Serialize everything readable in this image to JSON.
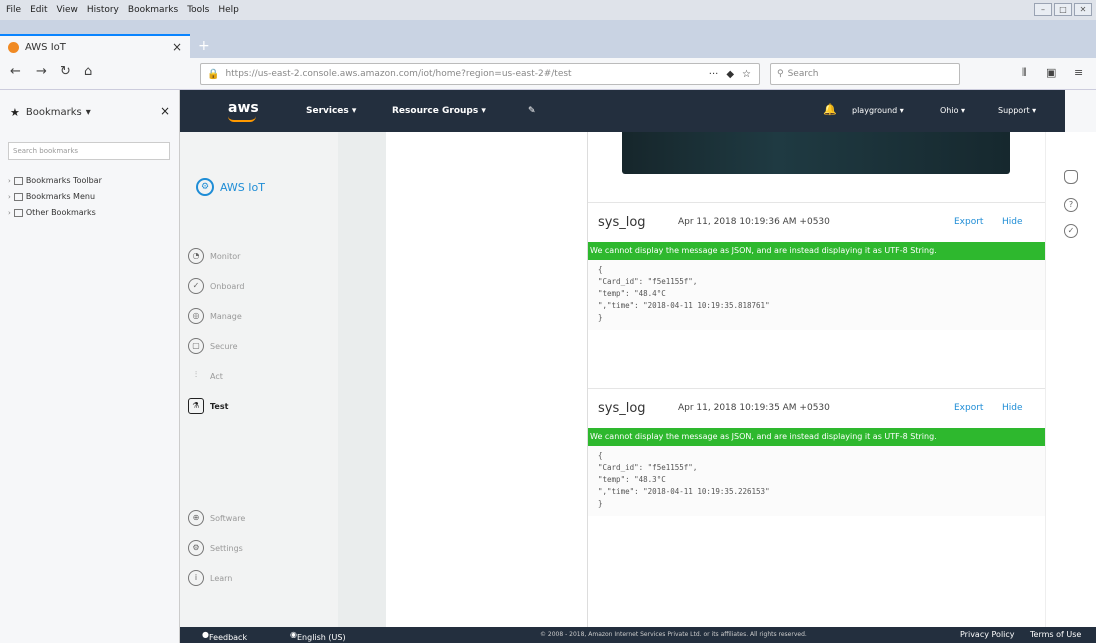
{
  "menubar": {
    "items": [
      "File",
      "Edit",
      "View",
      "History",
      "Bookmarks",
      "Tools",
      "Help"
    ]
  },
  "tab": {
    "title": "AWS IoT",
    "close": "×",
    "newtab": "+"
  },
  "nav": {
    "url": "https://us-east-2.console.aws.amazon.com/iot/home?region=us-east-2#/test",
    "more": "···",
    "search_placeholder": "Search"
  },
  "bookmarks": {
    "title": "Bookmarks",
    "close": "×",
    "search_placeholder": "Search bookmarks",
    "items": [
      "Bookmarks Toolbar",
      "Bookmarks Menu",
      "Other Bookmarks"
    ]
  },
  "aws": {
    "logo": "aws",
    "services": "Services",
    "resource_groups": "Resource Groups",
    "account": "playground",
    "region": "Ohio",
    "support": "Support"
  },
  "iot": {
    "title": "AWS IoT",
    "nav": [
      "Monitor",
      "Onboard",
      "Manage",
      "Secure",
      "Act",
      "Test"
    ],
    "bottom_nav": [
      "Software",
      "Settings",
      "Learn"
    ]
  },
  "messages": [
    {
      "topic": "sys_log",
      "timestamp": "Apr 11, 2018 10:19:36 AM +0530",
      "export": "Export",
      "hide": "Hide",
      "banner": "We cannot display the message as JSON, and are instead displaying it as UTF-8 String.",
      "payload": "{\n\"Card_id\": \"f5e1155f\",\n\"temp\": \"48.4°C\n\",\"time\": \"2018-04-11 10:19:35.818761\"\n}"
    },
    {
      "topic": "sys_log",
      "timestamp": "Apr 11, 2018 10:19:35 AM +0530",
      "export": "Export",
      "hide": "Hide",
      "banner": "We cannot display the message as JSON, and are instead displaying it as UTF-8 String.",
      "payload": "{\n\"Card_id\": \"f5e1155f\",\n\"temp\": \"48.3°C\n\",\"time\": \"2018-04-11 10:19:35.226153\"\n}"
    }
  ],
  "footer": {
    "feedback": "Feedback",
    "language": "English (US)",
    "copyright": "© 2008 - 2018, Amazon Internet Services Private Ltd. or its affiliates. All rights reserved.",
    "privacy": "Privacy Policy",
    "terms": "Terms of Use"
  }
}
